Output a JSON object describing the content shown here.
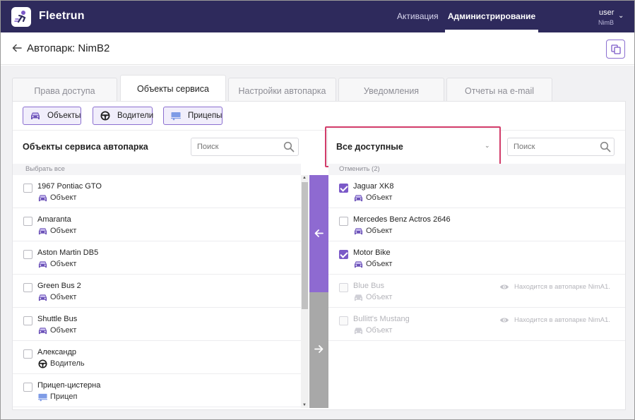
{
  "app": {
    "brand": "Fleetrun"
  },
  "nav": {
    "activation": "Активация",
    "administration": "Администрирование"
  },
  "user": {
    "name": "user",
    "org": "NimB"
  },
  "page": {
    "title": "Автопарк: NimB2"
  },
  "tabs": [
    "Права доступа",
    "Объекты сервиса",
    "Настройки автопарка",
    "Уведомления",
    "Отчеты на e-mail"
  ],
  "type_buttons": {
    "objects": "Объекты",
    "drivers": "Водители",
    "trailers": "Прицепы"
  },
  "left_panel": {
    "title": "Объекты сервиса автопарка",
    "search_placeholder": "Поиск",
    "select_all": "Выбрать все",
    "items": [
      {
        "name": "1967 Pontiac GTO",
        "type": "Объект"
      },
      {
        "name": "Amaranta",
        "type": "Объект"
      },
      {
        "name": "Aston Martin DB5",
        "type": "Объект"
      },
      {
        "name": "Green Bus 2",
        "type": "Объект"
      },
      {
        "name": "Shuttle Bus",
        "type": "Объект"
      },
      {
        "name": "Александр",
        "type": "Водитель"
      },
      {
        "name": "Прицеп-цистерна",
        "type": "Прицеп"
      }
    ]
  },
  "right_panel": {
    "filter_value": "Все доступные",
    "search_placeholder": "Поиск",
    "cancel_label": "Отменить (2)",
    "items": [
      {
        "name": "Jaguar XK8",
        "type": "Объект",
        "checked": true
      },
      {
        "name": "Mercedes Benz Actros 2646",
        "type": "Объект",
        "checked": false
      },
      {
        "name": "Motor Bike",
        "type": "Объект",
        "checked": true
      },
      {
        "name": "Blue Bus",
        "type": "Объект",
        "checked": false,
        "note": "Находится в автопарке NimA1."
      },
      {
        "name": "Bullitt's Mustang",
        "type": "Объект",
        "checked": false,
        "note": "Находится в автопарке NimA1."
      }
    ]
  },
  "colors": {
    "header_bg": "#2e2a5c",
    "accent": "#8e6ad1",
    "highlight": "#d23c6a"
  }
}
